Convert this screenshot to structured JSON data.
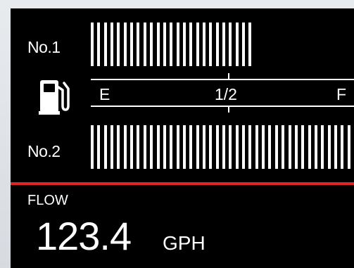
{
  "gauge": {
    "tank1": {
      "label": "No.1",
      "level": 0.62
    },
    "tank2": {
      "label": "No.2",
      "level": 1.0
    },
    "scale": {
      "empty": "E",
      "half": "1/2",
      "full": "F"
    },
    "icon": "fuel-pump-icon"
  },
  "flow": {
    "label": "FLOW",
    "value": "123.4",
    "unit": "GPH"
  },
  "colors": {
    "screen_background": "#000000",
    "text": "#ffffff",
    "divider": "#e02424"
  }
}
